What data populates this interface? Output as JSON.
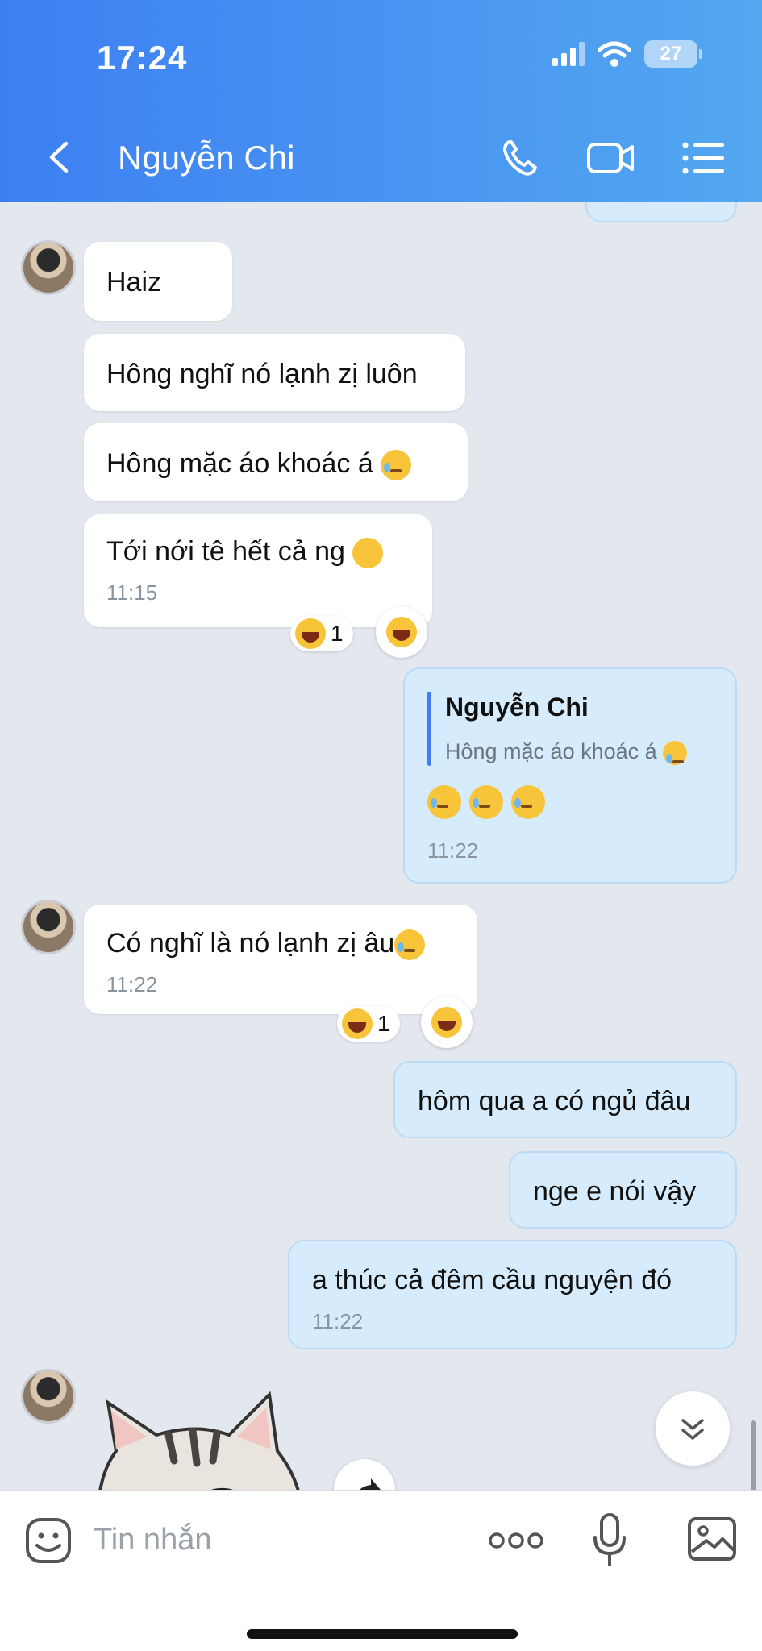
{
  "status": {
    "time": "17:24",
    "battery": "27"
  },
  "header": {
    "title": "Nguyễn Chi"
  },
  "messages": {
    "m1": {
      "text": "Haiz"
    },
    "m2": {
      "text": "Hông nghĩ nó lạnh zị luôn"
    },
    "m3": {
      "text": "Hông mặc áo khoác á"
    },
    "m4": {
      "text": "Tới nới tê hết cả ng",
      "time": "11:15",
      "reaction_count": "1"
    },
    "reply": {
      "quote_name": "Nguyễn Chi",
      "quote_text": "Hông mặc áo khoác á",
      "time": "11:22"
    },
    "m5": {
      "text": "Có nghĩ là nó lạnh zị âu",
      "time": "11:22",
      "reaction_count": "1"
    },
    "o1": {
      "text": "hôm qua a có ngủ đâu"
    },
    "o2": {
      "text": "nge e nói vậy"
    },
    "o3": {
      "text": "a thúc cả đêm cầu nguyện đó",
      "time": "11:22"
    }
  },
  "input": {
    "placeholder": "Tin nhắn"
  },
  "icons": {
    "back": "chevron-left-icon",
    "call": "phone-icon",
    "video": "video-icon",
    "menu": "list-icon",
    "sticker": "sticker-icon",
    "more": "more-dots-icon",
    "mic": "microphone-icon",
    "image": "image-icon",
    "scroll": "chevron-double-down-icon",
    "forward": "forward-icon"
  },
  "colors": {
    "header": "#3d7ff2",
    "outgoing_bubble": "#d6ebfb",
    "incoming_bubble": "#ffffff",
    "background": "#e3e7ee"
  }
}
